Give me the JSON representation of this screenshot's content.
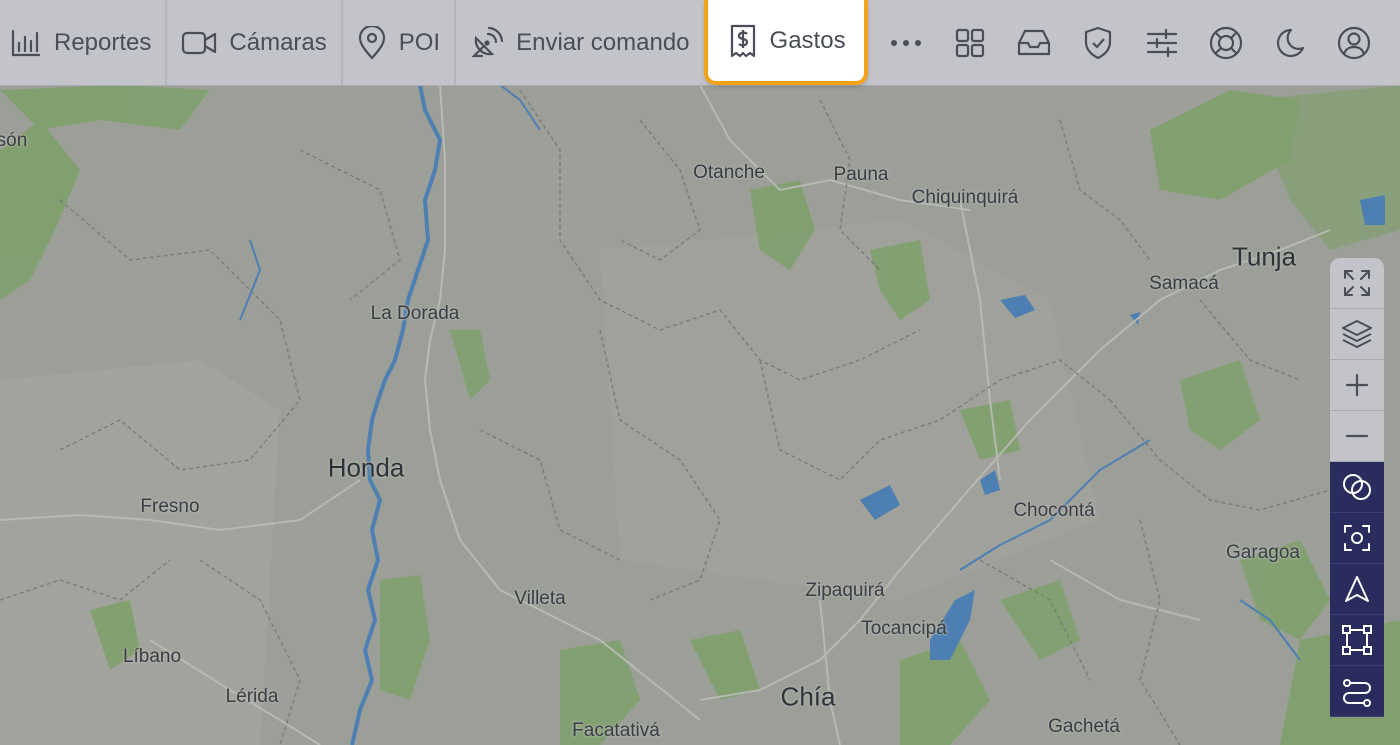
{
  "nav": {
    "items": [
      {
        "label": "Reportes",
        "icon": "bar-chart-icon"
      },
      {
        "label": "Cámaras",
        "icon": "video-camera-icon"
      },
      {
        "label": "POI",
        "icon": "map-pin-icon"
      },
      {
        "label": "Enviar comando",
        "icon": "satellite-dish-icon"
      },
      {
        "label": "Gastos",
        "icon": "receipt-dollar-icon",
        "active": true
      }
    ],
    "icons": [
      "more-dots-icon",
      "apps-grid-icon",
      "inbox-icon",
      "shield-check-icon",
      "sliders-icon",
      "lifebuoy-icon",
      "moon-icon",
      "user-circle-icon"
    ]
  },
  "map": {
    "places": [
      {
        "name": "són"
      },
      {
        "name": "Otanche"
      },
      {
        "name": "Pauna"
      },
      {
        "name": "Chiquinquirá"
      },
      {
        "name": "Tunja"
      },
      {
        "name": "Samacá"
      },
      {
        "name": "La Dorada"
      },
      {
        "name": "Honda"
      },
      {
        "name": "Fresno"
      },
      {
        "name": "Chocontá"
      },
      {
        "name": "Garagoa"
      },
      {
        "name": "Villeta"
      },
      {
        "name": "Zipaquirá"
      },
      {
        "name": "Tocancipá"
      },
      {
        "name": "Líbano"
      },
      {
        "name": "Lérida"
      },
      {
        "name": "Chía"
      },
      {
        "name": "Facatativá"
      },
      {
        "name": "Gachetá"
      }
    ]
  },
  "toolbar": {
    "buttons": [
      "fullscreen-icon",
      "layers-icon",
      "zoom-in-icon",
      "zoom-out-icon",
      "geofence-icon",
      "focus-icon",
      "navigate-icon",
      "select-area-icon",
      "route-icon"
    ]
  },
  "colors": {
    "topbar": "#c3c4c9",
    "active_border": "#f3a21b",
    "toolbar_dark": "#2a2c5e",
    "map_base": "#9c9f98",
    "water": "#4d7fb3",
    "forest": "#7ea06a"
  }
}
